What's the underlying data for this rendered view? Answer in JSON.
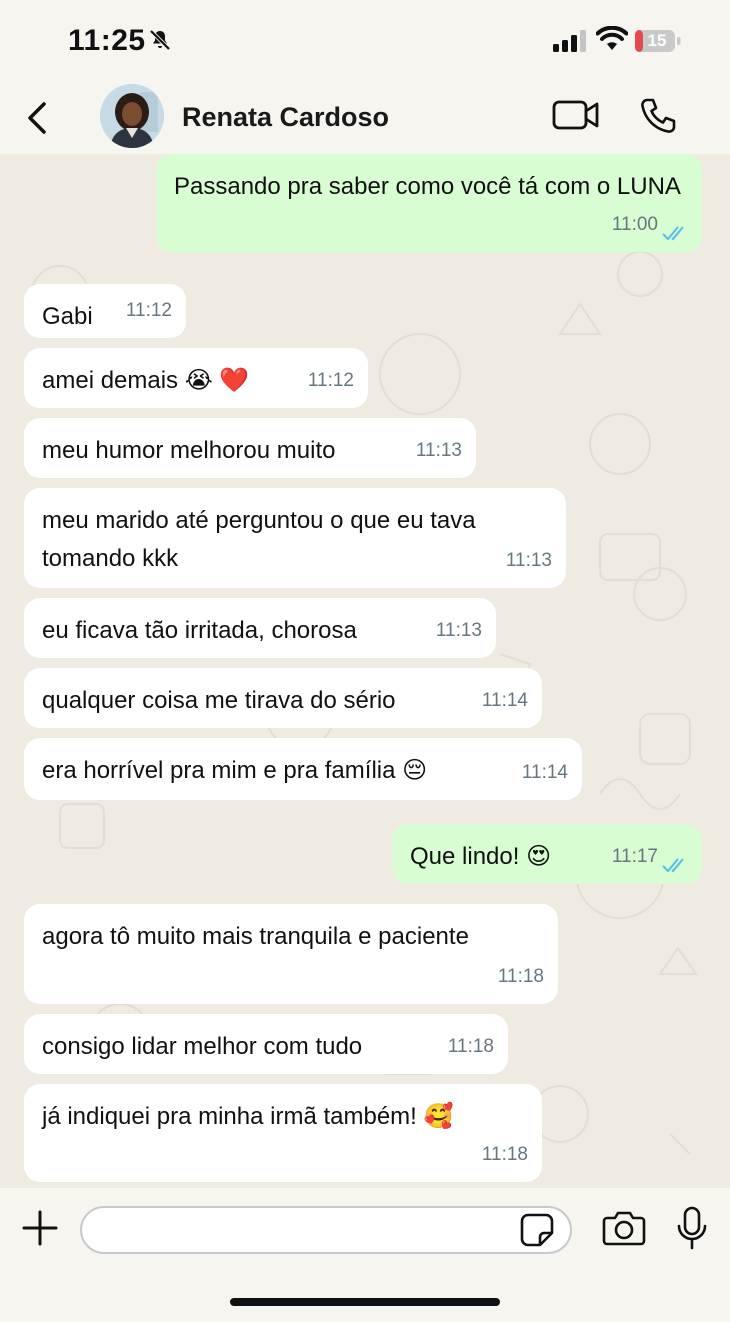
{
  "status": {
    "time": "11:25",
    "battery": "15"
  },
  "header": {
    "contact_name": "Renata Cardoso"
  },
  "messages": [
    {
      "dir": "out",
      "text": "Passando pra saber como você tá com o LUNA",
      "time": "11:00"
    },
    {
      "dir": "in",
      "text": "Gabi",
      "time": "11:12"
    },
    {
      "dir": "in",
      "text": "amei demais 😭 ❤️",
      "time": "11:12"
    },
    {
      "dir": "in",
      "text": "meu humor melhorou muito",
      "time": "11:13"
    },
    {
      "dir": "in",
      "text": "meu marido até perguntou o que eu tava tomando kkk",
      "time": "11:13"
    },
    {
      "dir": "in",
      "text": "eu ficava tão irritada, chorosa",
      "time": "11:13"
    },
    {
      "dir": "in",
      "text": "qualquer coisa me tirava do sério",
      "time": "11:14"
    },
    {
      "dir": "in",
      "text": "era horrível pra mim e pra família 😔",
      "time": "11:14"
    },
    {
      "dir": "out",
      "text": "Que lindo! 😍",
      "time": "11:17"
    },
    {
      "dir": "in",
      "text": "agora tô muito mais tranquila e paciente",
      "time": "11:18"
    },
    {
      "dir": "in",
      "text": "consigo lidar melhor com tudo",
      "time": "11:18"
    },
    {
      "dir": "in",
      "text": "já indiquei pra minha irmã também! 🥰",
      "time": "11:18"
    }
  ],
  "composer": {
    "placeholder": ""
  },
  "colors": {
    "incoming_bubble": "#ffffff",
    "outgoing_bubble": "#d8fdd2",
    "read_ticks": "#53bdeb",
    "battery_low": "#e5484d"
  }
}
